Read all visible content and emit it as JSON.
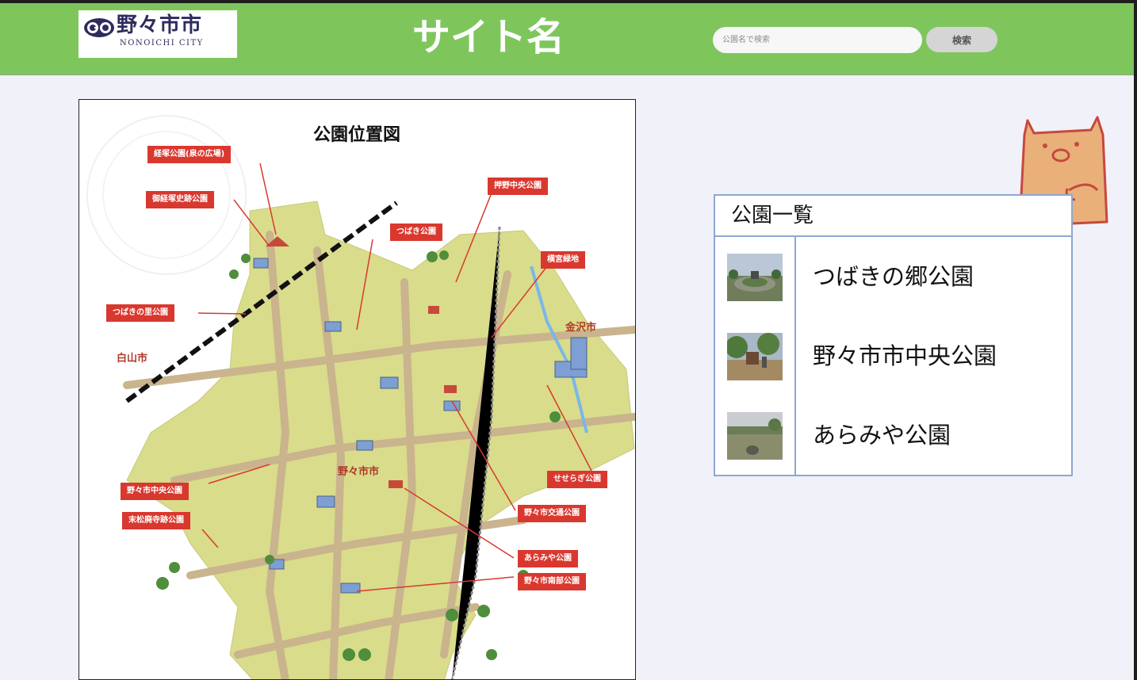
{
  "header": {
    "logo_main": "野々市市",
    "logo_sub": "NONOICHI CITY",
    "site_title": "サイト名",
    "search_placeholder": "公園名で検索",
    "search_button": "検索",
    "colors": {
      "header_bg": "#7ec65c",
      "accent_red": "#d9382f"
    }
  },
  "map": {
    "title": "公園位置図",
    "labels": [
      "経塚公園(泉の広場)",
      "御経塚史跡公園",
      "押野中央公園",
      "つばき公園",
      "横宮緑地",
      "つばきの里公園",
      "野々市中央公園",
      "末松廃寺跡公園",
      "せせらぎ公園",
      "野々市交通公園",
      "あらみや公園",
      "野々市南部公園"
    ],
    "cities": [
      "白山市",
      "金沢市",
      "野々市市"
    ]
  },
  "park_list": {
    "title": "公園一覧",
    "items": [
      {
        "name": "つばきの郷公園",
        "thumb_icon": "park-photo-icon"
      },
      {
        "name": "野々市市中央公園",
        "thumb_icon": "playground-photo-icon"
      },
      {
        "name": "あらみや公園",
        "thumb_icon": "field-photo-icon"
      }
    ]
  }
}
